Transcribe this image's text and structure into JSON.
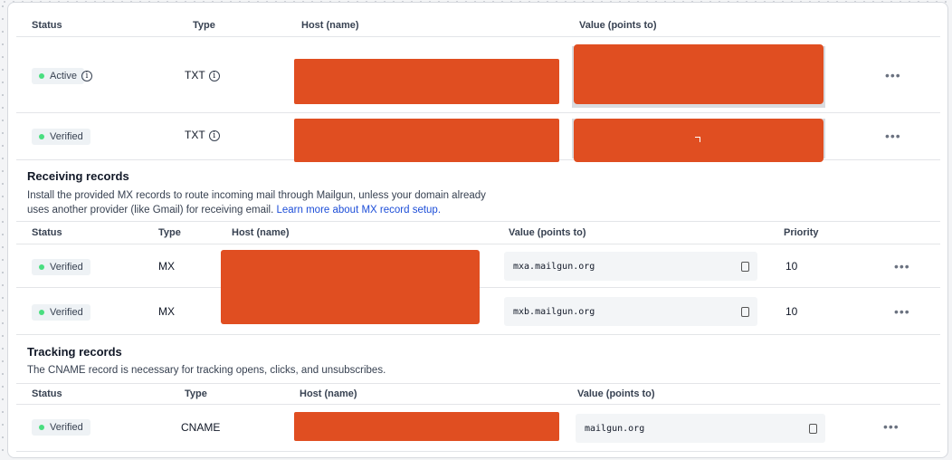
{
  "sending": {
    "headers": {
      "status": "Status",
      "type": "Type",
      "host": "Host (name)",
      "value": "Value (points to)"
    },
    "rows": [
      {
        "status": "Active",
        "type": "TXT"
      },
      {
        "status": "Verified",
        "type": "TXT"
      }
    ]
  },
  "receiving": {
    "title": "Receiving records",
    "desc": "Install the provided MX records to route incoming mail through Mailgun, unless your domain already uses another provider (like Gmail) for receiving email.",
    "link": "Learn more about MX record setup.",
    "headers": {
      "status": "Status",
      "type": "Type",
      "host": "Host (name)",
      "value": "Value (points to)",
      "priority": "Priority"
    },
    "rows": [
      {
        "status": "Verified",
        "type": "MX",
        "value": "mxa.mailgun.org",
        "priority": "10"
      },
      {
        "status": "Verified",
        "type": "MX",
        "value": "mxb.mailgun.org",
        "priority": "10"
      }
    ]
  },
  "tracking": {
    "title": "Tracking records",
    "desc": "The CNAME record is necessary for tracking opens, clicks, and unsubscribes.",
    "headers": {
      "status": "Status",
      "type": "Type",
      "host": "Host (name)",
      "value": "Value (points to)"
    },
    "rows": [
      {
        "status": "Verified",
        "type": "CNAME",
        "value": "mailgun.org"
      }
    ]
  },
  "icons": {
    "info": "info-icon",
    "copy": "copy-icon",
    "more": "more-actions-icon"
  },
  "colors": {
    "redaction": "#e04e21",
    "status_dot": "#4ade80",
    "link": "#1d4ed8"
  }
}
